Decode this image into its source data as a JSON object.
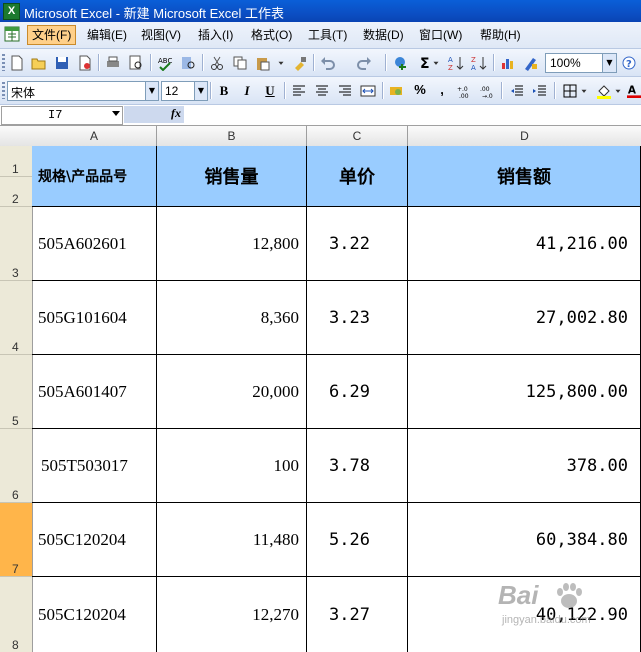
{
  "window": {
    "title": "Microsoft Excel - 新建 Microsoft Excel 工作表"
  },
  "menu": [
    "文件(F)",
    "编辑(E)",
    "视图(V)",
    "插入(I)",
    "格式(O)",
    "工具(T)",
    "数据(D)",
    "窗口(W)",
    "帮助(H)"
  ],
  "toolbar": {
    "zoom": "100%"
  },
  "format_toolbar": {
    "font": "宋体",
    "size": "12",
    "bold": "B",
    "italic": "I",
    "underline": "U",
    "percent": "%",
    "comma": ","
  },
  "formula_bar": {
    "name_box": "I7",
    "fx": "fx"
  },
  "columns": [
    "A",
    "B",
    "C",
    "D"
  ],
  "row_numbers": [
    "1",
    "2",
    "3",
    "4",
    "5",
    "6",
    "7",
    "8"
  ],
  "selected_row": "7",
  "table": {
    "headers": [
      "规格\\产品品号",
      "销售量",
      "单价",
      "销售额"
    ],
    "rows": [
      [
        "505A602601",
        "12,800",
        "3.22",
        "41,216.00"
      ],
      [
        "505G101604",
        "8,360",
        "3.23",
        "27,002.80"
      ],
      [
        "505A601407",
        "20,000",
        "6.29",
        "125,800.00"
      ],
      [
        "505T503017",
        "100",
        "3.78",
        "378.00"
      ],
      [
        "505C120204",
        "11,480",
        "5.26",
        "60,384.80"
      ],
      [
        "505C120204",
        "12,270",
        "3.27",
        "40,122.90"
      ]
    ]
  },
  "watermark": {
    "brand": "Bai",
    "url": "jingyan.baidu.com"
  },
  "colors": {
    "header_fill": "#99ccff",
    "selected_row": "#ffb54a"
  }
}
